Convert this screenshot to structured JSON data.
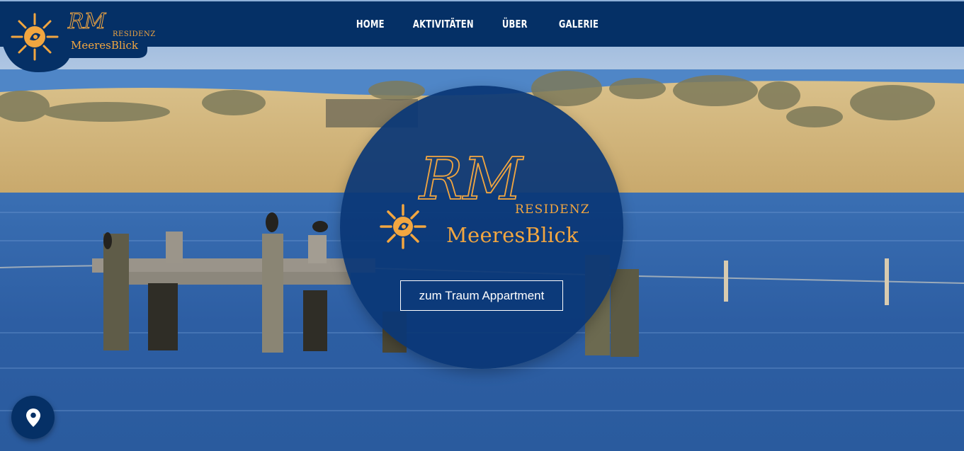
{
  "brand": {
    "monogram": "RM",
    "residenz": "RESIDENZ",
    "name": "MeeresBlick"
  },
  "nav": {
    "items": [
      {
        "label": "HOME"
      },
      {
        "label": "AKTIVITÄTEN"
      },
      {
        "label": "ÜBER"
      },
      {
        "label": "GALERIE"
      }
    ]
  },
  "hero": {
    "cta_label": "zum Traum Appartment"
  },
  "icons": {
    "logo": "sun-shell-logo-icon",
    "location": "map-pin-icon"
  },
  "colors": {
    "navy": "#053066",
    "accent_orange": "#f2a640",
    "white": "#ffffff"
  }
}
